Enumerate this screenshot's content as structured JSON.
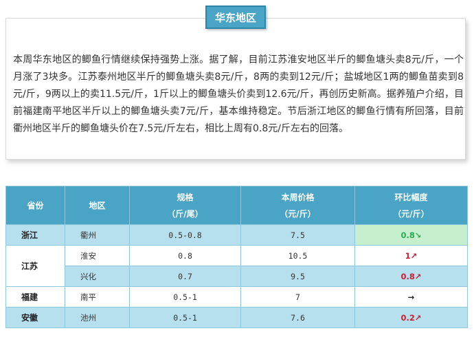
{
  "section": {
    "tag": "华东地区",
    "paragraph": "本周华东地区的鲫鱼行情继续保持强势上涨。据了解，目前江苏淮安地区半斤的鲫鱼塘头卖8元/斤，一个月涨了3块多。江苏泰州地区半斤的鲫鱼塘头卖8元/斤，8两的卖到12元/斤；盐城地区1两的鲫鱼苗卖到8元/斤，9两以上的卖11.5元/斤，1斤以上的鲫鱼塘头价卖到12.6元/斤，再创历史新高。据养殖户介绍，目前福建南平地区半斤以上的鲫鱼塘头卖7元/斤，基本维持稳定。节后浙江地区的鲫鱼行情有所回落，目前衢州地区半斤的鲫鱼塘头价在7.5元/斤左右，相比上周有0.8元/斤左右的回落。"
  },
  "table": {
    "headers": {
      "province": "省份",
      "area": "地区",
      "spec_line1": "规格",
      "spec_line2": "（斤/尾）",
      "price_line1": "本周价格",
      "price_line2": "（元/斤）",
      "change_line1": "环比幅度",
      "change_line2": "（元/斤）"
    },
    "rows": [
      {
        "province": "浙江",
        "area": "衢州",
        "spec": "0.5-0.8",
        "price": "7.5",
        "change": "0.8",
        "arrow": "↘",
        "trend": "down"
      },
      {
        "province": "江苏",
        "area": "淮安",
        "spec": "0.8",
        "price": "10.5",
        "change": "1",
        "arrow": "↗",
        "trend": "up"
      },
      {
        "province": "",
        "area": "兴化",
        "spec": "0.7",
        "price": "9.5",
        "change": "0.8",
        "arrow": "↗",
        "trend": "up"
      },
      {
        "province": "福建",
        "area": "南平",
        "spec": "0.5-1",
        "price": "7",
        "change": "",
        "arrow": "→",
        "trend": "flat"
      },
      {
        "province": "安徽",
        "area": "池州",
        "spec": "0.5-1",
        "price": "7.6",
        "change": "0.2",
        "arrow": "↗",
        "trend": "up"
      }
    ]
  },
  "colors": {
    "header_bg": "#4aa4c5",
    "row_blue": "#b7e0ee",
    "down": "#2bab55",
    "up": "#d21c31"
  }
}
